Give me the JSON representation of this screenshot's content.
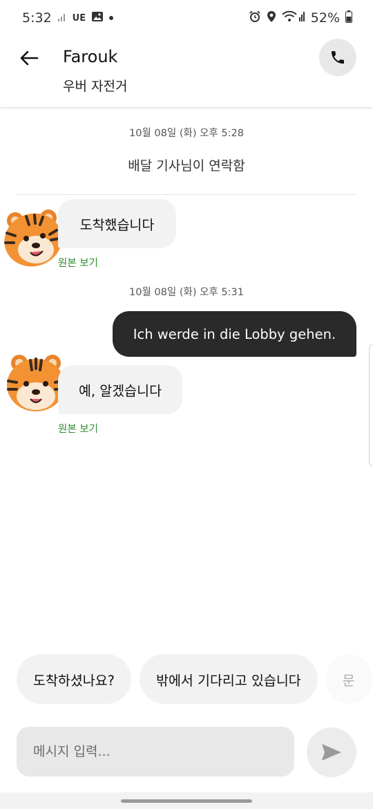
{
  "status_bar": {
    "time": "5:32",
    "network_label": "UE",
    "battery": "52%"
  },
  "header": {
    "contact_name": "Farouk",
    "vehicle": "우버 자전거"
  },
  "chat": {
    "timestamp_1": "10월 08일 (화) 오후 5:28",
    "system_message": "배달 기사님이 연락함",
    "message_1": "도착했습니다",
    "view_original_1": "원본 보기",
    "timestamp_2": "10월 08일 (화) 오후 5:31",
    "message_2": "Ich werde in die Lobby gehen.",
    "message_3": "예, 알겠습니다",
    "view_original_2": "원본 보기"
  },
  "quick_replies": [
    "도착하셨나요?",
    "밖에서 기다리고 있습니다",
    "문"
  ],
  "composer": {
    "placeholder": "메시지 입력..."
  },
  "icons": {
    "back": "arrow-left-icon",
    "call": "phone-icon",
    "send": "send-icon",
    "avatar": "tiger-avatar"
  },
  "colors": {
    "outgoing_bubble": "#2a2a2a",
    "incoming_bubble": "#f2f2f2",
    "link_green": "#2e8a2e"
  }
}
